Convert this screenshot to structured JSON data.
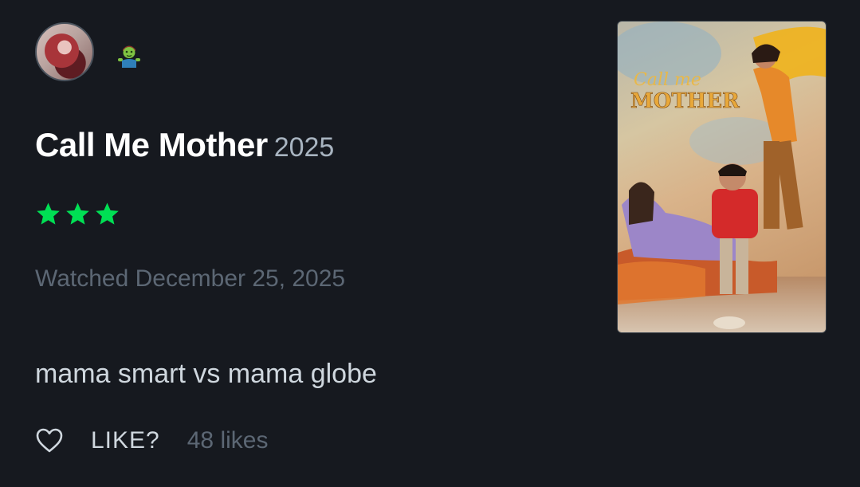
{
  "review": {
    "badge_icon": "zombie-emoji",
    "film_title": "Call Me Mother",
    "film_year": "2025",
    "rating_stars": 3,
    "rating_color": "#00e054",
    "watched_text": "Watched December 25, 2025",
    "body": "mama smart vs mama globe",
    "like_label": "LIKE?",
    "likes_text": "48 likes"
  },
  "poster": {
    "title_line1": "Call me",
    "title_line2": "MOTHER"
  },
  "colors": {
    "background": "#16191f",
    "title": "#ffffff",
    "muted": "#5c6774",
    "text": "#cfd7de",
    "star": "#00e054"
  }
}
